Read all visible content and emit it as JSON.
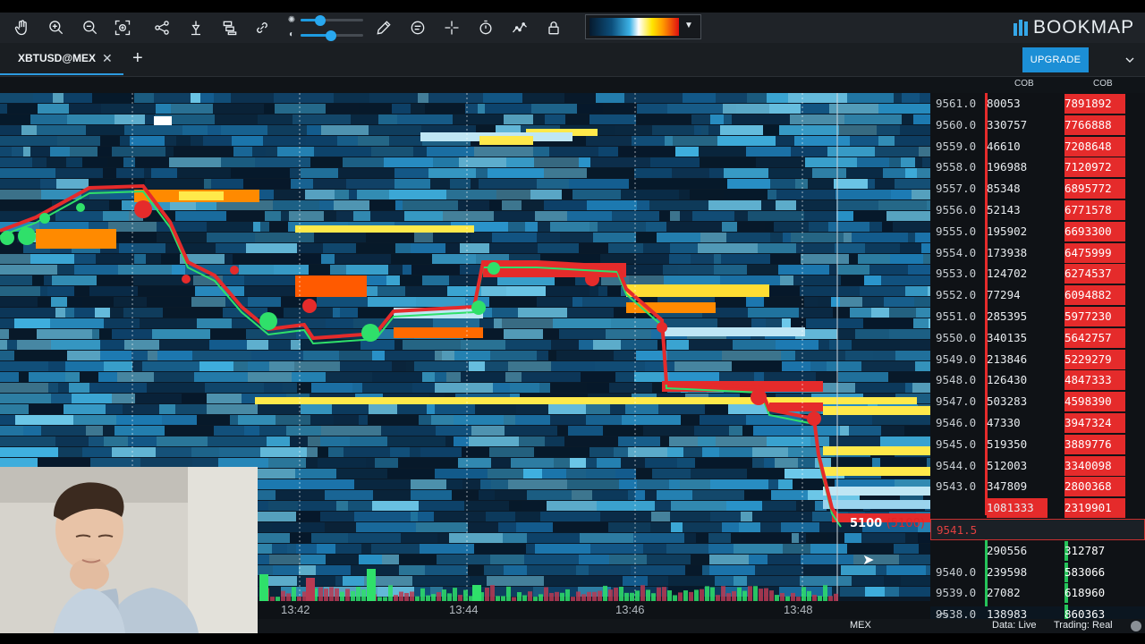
{
  "toolbar": {
    "icons": [
      "hand-icon",
      "zoom-in-icon",
      "zoom-out-icon",
      "zoom-fit-icon",
      "share-icon",
      "indicators-icon",
      "layers-icon",
      "link-icon",
      "pencil-icon",
      "chat-icon",
      "crosshair-icon",
      "timer-icon",
      "chart-line-icon",
      "lock-icon"
    ],
    "brand": "BOOKMAP"
  },
  "tabs": [
    {
      "label": "XBTUSD@MEX"
    }
  ],
  "header_buttons": {
    "upgrade": "UPGRADE"
  },
  "ladder": {
    "col1_header": "COB",
    "col2_header": "COB",
    "rows": [
      {
        "price": "9561.0",
        "cob": "80053",
        "cob2": "7891892"
      },
      {
        "price": "9560.0",
        "cob": "330757",
        "cob2": "7766888"
      },
      {
        "price": "9559.0",
        "cob": "46610",
        "cob2": "7208648"
      },
      {
        "price": "9558.0",
        "cob": "196988",
        "cob2": "7120972"
      },
      {
        "price": "9557.0",
        "cob": "85348",
        "cob2": "6895772"
      },
      {
        "price": "9556.0",
        "cob": "52143",
        "cob2": "6771578"
      },
      {
        "price": "9555.0",
        "cob": "195902",
        "cob2": "6693300"
      },
      {
        "price": "9554.0",
        "cob": "173938",
        "cob2": "6475999"
      },
      {
        "price": "9553.0",
        "cob": "124702",
        "cob2": "6274537"
      },
      {
        "price": "9552.0",
        "cob": "77294",
        "cob2": "6094882"
      },
      {
        "price": "9551.0",
        "cob": "285395",
        "cob2": "5977230"
      },
      {
        "price": "9550.0",
        "cob": "340135",
        "cob2": "5642757"
      },
      {
        "price": "9549.0",
        "cob": "213846",
        "cob2": "5229279"
      },
      {
        "price": "9548.0",
        "cob": "126430",
        "cob2": "4847333"
      },
      {
        "price": "9547.0",
        "cob": "503283",
        "cob2": "4598390"
      },
      {
        "price": "9546.0",
        "cob": "47330",
        "cob2": "3947324"
      },
      {
        "price": "9545.0",
        "cob": "519350",
        "cob2": "3889776"
      },
      {
        "price": "9544.0",
        "cob": "512003",
        "cob2": "3340098"
      },
      {
        "price": "9543.0",
        "cob": "347809",
        "cob2": "2800368"
      },
      {
        "price": "",
        "cob": "1081333",
        "cob2": "2319901"
      },
      {
        "price": "9541.5",
        "cob": "",
        "cob2": ""
      },
      {
        "price": "",
        "cob": "290556",
        "cob2": "312787"
      },
      {
        "price": "9540.0",
        "cob": "239598",
        "cob2": "583066"
      },
      {
        "price": "9539.0",
        "cob": "27082",
        "cob2": "618960"
      },
      {
        "price": "9538.0",
        "cob": "138983",
        "cob2": "860363"
      }
    ]
  },
  "position": {
    "size": "5100",
    "pending": "(5100)"
  },
  "time_axis": {
    "ticks": [
      "13:42",
      "13:44",
      "13:46",
      "13:48"
    ]
  },
  "status": {
    "exchange": "MEX",
    "data": "Data: Live",
    "trading": "Trading: Real"
  },
  "colors": {
    "accent": "#1c8fd6",
    "ask": "#e52b2b",
    "bid": "#25c35a",
    "heat_high": "#ffe600"
  }
}
